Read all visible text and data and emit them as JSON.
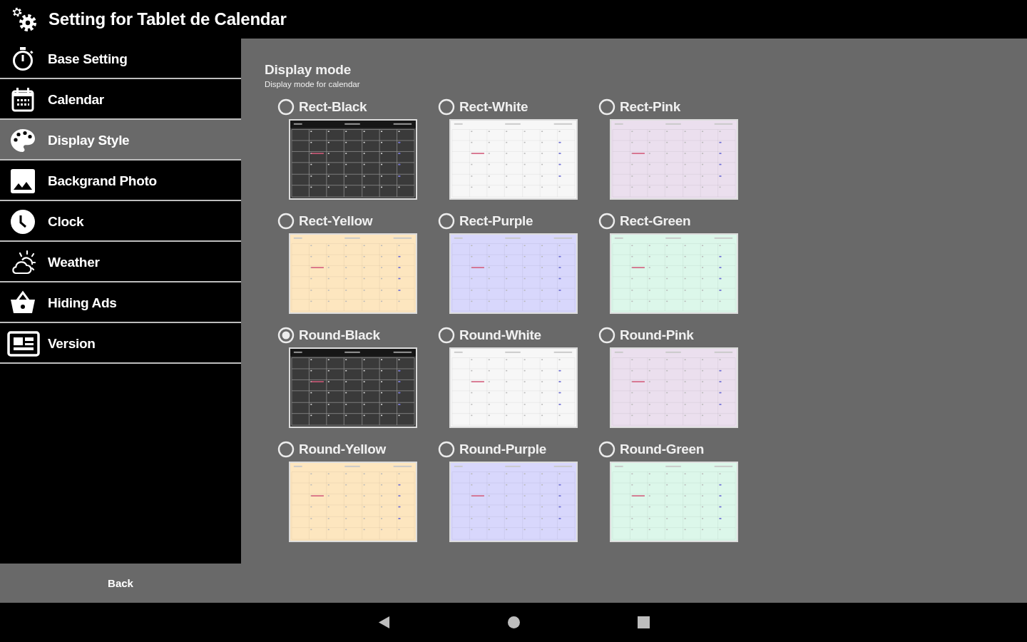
{
  "app_bar": {
    "title": "Setting for Tablet de Calendar"
  },
  "sidebar": {
    "items": [
      {
        "label": "Base Setting",
        "selected": false
      },
      {
        "label": "Calendar",
        "selected": false
      },
      {
        "label": "Display Style",
        "selected": true
      },
      {
        "label": "Backgrand Photo",
        "selected": false
      },
      {
        "label": "Clock",
        "selected": false
      },
      {
        "label": "Weather",
        "selected": false
      },
      {
        "label": "Hiding Ads",
        "selected": false
      },
      {
        "label": "Version",
        "selected": false
      }
    ]
  },
  "display_mode": {
    "title": "Display mode",
    "subtitle": "Display mode for calendar",
    "options": [
      {
        "label": "Rect-Black",
        "selected": false,
        "color": "#3a3a3a"
      },
      {
        "label": "Rect-White",
        "selected": false,
        "color": "#f7f7f7"
      },
      {
        "label": "Rect-Pink",
        "selected": false,
        "color": "#ebdfee"
      },
      {
        "label": "Rect-Yellow",
        "selected": false,
        "color": "#fde6bf"
      },
      {
        "label": "Rect-Purple",
        "selected": false,
        "color": "#d8d7fc"
      },
      {
        "label": "Rect-Green",
        "selected": false,
        "color": "#dcf7ea"
      },
      {
        "label": "Round-Black",
        "selected": true,
        "color": "#3a3a3a"
      },
      {
        "label": "Round-White",
        "selected": false,
        "color": "#f7f7f7"
      },
      {
        "label": "Round-Pink",
        "selected": false,
        "color": "#ebdfee"
      },
      {
        "label": "Round-Yellow",
        "selected": false,
        "color": "#fde6bf"
      },
      {
        "label": "Round-Purple",
        "selected": false,
        "color": "#d8d7fc"
      },
      {
        "label": "Round-Green",
        "selected": false,
        "color": "#dcf7ea"
      }
    ]
  },
  "back_button": {
    "label": "Back"
  }
}
